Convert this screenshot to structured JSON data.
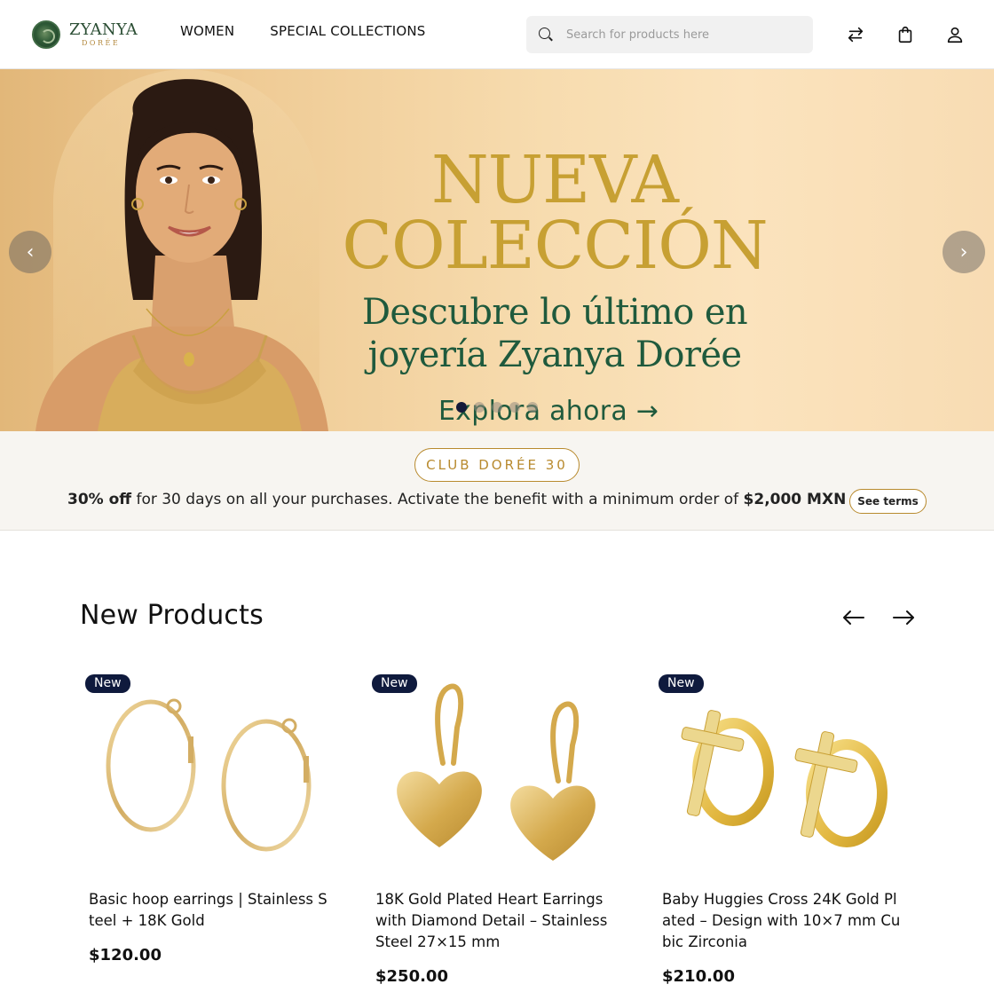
{
  "header": {
    "logo_name": "ZYANYA",
    "logo_sub": "DORÉE",
    "nav": [
      "WOMEN",
      "SPECIAL COLLECTIONS"
    ],
    "search_placeholder": "Search for products here",
    "icons": [
      "search-icon",
      "compare-icon",
      "shopping-bag-icon",
      "user-icon"
    ]
  },
  "hero": {
    "title_line1": "NUEVA",
    "title_line2": "COLECCIÓN",
    "subtitle_line1": "Descubre lo último en",
    "subtitle_line2": "joyería Zyanya Dorée",
    "cta": "Explora ahora →",
    "slides": 5,
    "active_slide": 1,
    "prev_symbol": "‹",
    "next_symbol": "›"
  },
  "promo": {
    "club_label": "CLUB DORÉE 30",
    "discount": "30% off",
    "text_middle": " for 30 days on all your purchases. Activate the benefit with a minimum order of ",
    "minimum": "$2,000 MXN",
    "text_end": " .",
    "terms_label": "See terms"
  },
  "products_section": {
    "title": "New Products",
    "items": [
      {
        "badge": "New",
        "name": "Basic hoop earrings | Stainless Steel + 18K Gold",
        "price": "$120.00"
      },
      {
        "badge": "New",
        "name": "18K Gold Plated Heart Earrings with Diamond Detail – Stainless Steel 27×15 mm",
        "price": "$250.00"
      },
      {
        "badge": "New",
        "name": "Baby Huggies Cross 24K Gold Plated – Design with 10×7 mm Cubic Zirconia",
        "price": "$210.00"
      }
    ]
  },
  "colors": {
    "gold": "#c7a033",
    "green": "#1f5a3d",
    "navy": "#0f1a3d",
    "accent_border": "#b88a2e"
  }
}
